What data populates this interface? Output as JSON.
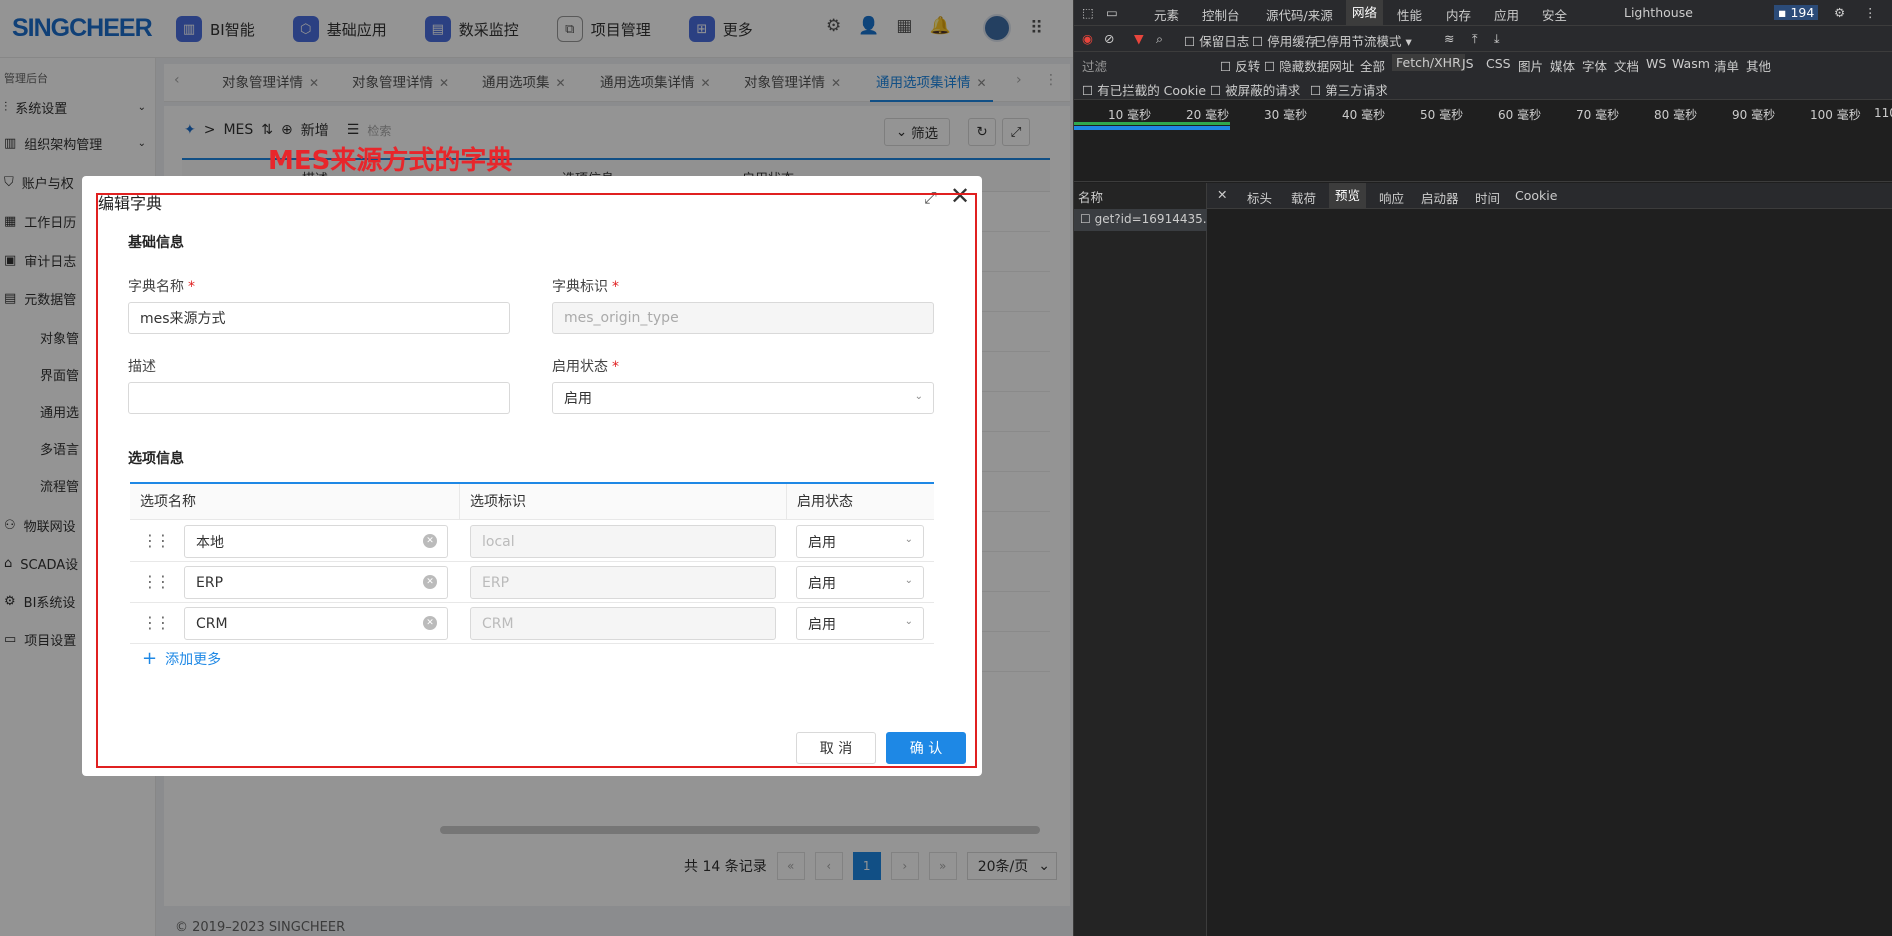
{
  "app": {
    "logo": "SINGCHEER",
    "nav": [
      {
        "label": "BI智能",
        "icon": "chart-icon"
      },
      {
        "label": "基础应用",
        "icon": "cube-icon"
      },
      {
        "label": "数采监控",
        "icon": "monitor-icon"
      },
      {
        "label": "项目管理",
        "icon": "project-icon"
      },
      {
        "label": "更多",
        "icon": "more-icon"
      }
    ]
  },
  "sidebar": {
    "title": "管理后台",
    "items": [
      "系统设置",
      "组织架构管理",
      "账户与权",
      "工作日历",
      "审计日志",
      "元数据管"
    ],
    "subitems": [
      "对象管",
      "界面管",
      "通用选",
      "多语言",
      "流程管"
    ],
    "more": [
      "物联网设",
      "SCADA设",
      "BI系统设",
      "项目设置"
    ]
  },
  "tabs": [
    "对象管理详情",
    "对象管理详情",
    "通用选项集",
    "通用选项集详情",
    "对象管理详情",
    "通用选项集详情"
  ],
  "breadcrumb": {
    "root": "MES",
    "add": "新增",
    "search": "检索",
    "filter": "筛选"
  },
  "table_headers": [
    "描述",
    "选项信息",
    "启用状态"
  ],
  "pager": {
    "total": "共 14 条记录",
    "page": "1",
    "per_page": "20条/页"
  },
  "footer": "© 2019–2023 SINGCHEER",
  "annotation": "MES来源方式的字典",
  "modal": {
    "title": "编辑字典",
    "basic": "基础信息",
    "name_label": "字典名称",
    "name_value": "mes来源方式",
    "code_label": "字典标识",
    "code_value": "mes_origin_type",
    "desc_label": "描述",
    "desc_value": "",
    "status_label": "启用状态",
    "status_value": "启用",
    "options_section": "选项信息",
    "opt_headers": [
      "选项名称",
      "选项标识",
      "启用状态"
    ],
    "options": [
      {
        "name": "本地",
        "code": "local",
        "status": "启用"
      },
      {
        "name": "ERP",
        "code": "ERP",
        "status": "启用"
      },
      {
        "name": "CRM",
        "code": "CRM",
        "status": "启用"
      }
    ],
    "add_more": "添加更多",
    "cancel": "取 消",
    "ok": "确 认"
  },
  "devtools": {
    "tabs": [
      "元素",
      "控制台",
      "源代码/来源",
      "网络",
      "性能",
      "内存",
      "应用",
      "安全",
      "Lighthouse"
    ],
    "badge": "194",
    "toolbar": {
      "preserve": "保留日志",
      "disable_cache": "停用缓存",
      "throttle": "已停用节流模式"
    },
    "filter": {
      "placeholder": "过滤",
      "invert": "反转",
      "hide_data": "隐藏数据网址",
      "all": "全部",
      "types": [
        "Fetch/XHR",
        "JS",
        "CSS",
        "图片",
        "媒体",
        "字体",
        "文档",
        "WS",
        "Wasm",
        "清单",
        "其他"
      ],
      "blocked_cookies": "有已拦截的 Cookie",
      "blocked_req": "被屏蔽的请求",
      "third_party": "第三方请求"
    },
    "ticks": [
      "10 毫秒",
      "20 毫秒",
      "30 毫秒",
      "40 毫秒",
      "50 毫秒",
      "60 毫秒",
      "70 毫秒",
      "80 毫秒",
      "90 毫秒",
      "100 毫秒",
      "110"
    ],
    "name_col": "名称",
    "request": "get?id=16914435...",
    "panel_tabs": [
      "标头",
      "载荷",
      "预览",
      "响应",
      "启动器",
      "时间",
      "Cookie"
    ]
  }
}
